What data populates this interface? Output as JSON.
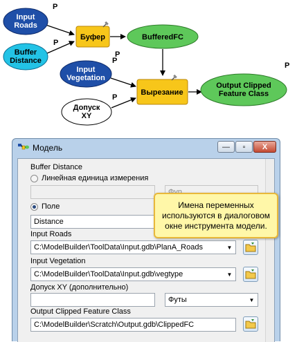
{
  "diagram": {
    "nodes": {
      "input_roads": "Input\nRoads",
      "buffer_distance": "Buffer\nDistance",
      "buffer_tool": "Буфер",
      "buffered_fc": "BufferedFC",
      "input_vegetation": "Input\nVegetation",
      "clip_tool": "Вырезание",
      "xy_tolerance": "Допуск\nXY",
      "output_clipped": "Output Clipped\nFeature Class"
    },
    "param_marker": "P"
  },
  "window": {
    "title": "Модель",
    "buttons": {
      "minimize": "—",
      "maximize": "▫",
      "close": "X"
    }
  },
  "form": {
    "buffer_distance_label": "Buffer Distance",
    "linear_unit_label": "Линейная единица измерения",
    "linear_unit_value": "",
    "linear_unit_units": "Фуn",
    "field_label": "Поле",
    "field_value": "Distance",
    "input_roads_label": "Input Roads",
    "input_roads_value": "C:\\ModelBuilder\\ToolData\\Input.gdb\\PlanA_Roads",
    "input_vegetation_label": "Input Vegetation",
    "input_vegetation_value": "C:\\ModelBuilder\\ToolData\\Input.gdb\\vegtype",
    "xy_tolerance_label": "Допуск XY (дополнительно)",
    "xy_tolerance_value": "",
    "xy_tolerance_units": "Футы",
    "output_label": "Output Clipped Feature Class",
    "output_value": "C:\\ModelBuilder\\Scratch\\Output.gdb\\ClippedFC"
  },
  "callout": {
    "text": "Имена переменных используются в диалоговом окне инструмента модели."
  },
  "colors": {
    "data_blue": "#1f4fa8",
    "data_cyan": "#23c3e6",
    "tool_yellow": "#f7c61a",
    "derived_green": "#5ec85a",
    "window_frame": "#b9d1ea",
    "callout_bg": "#fff7a8"
  }
}
